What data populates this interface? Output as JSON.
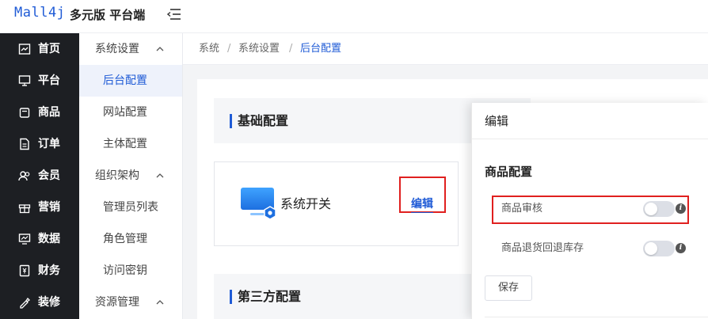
{
  "header": {
    "logo_text": "Mall4j",
    "brand_title": "多元版 平台端"
  },
  "main_nav": {
    "items": [
      {
        "label": "首页",
        "icon": "home-icon"
      },
      {
        "label": "平台",
        "icon": "monitor-icon"
      },
      {
        "label": "商品",
        "icon": "product-icon"
      },
      {
        "label": "订单",
        "icon": "order-icon"
      },
      {
        "label": "会员",
        "icon": "member-icon"
      },
      {
        "label": "营销",
        "icon": "gift-icon"
      },
      {
        "label": "数据",
        "icon": "chart-icon"
      },
      {
        "label": "财务",
        "icon": "finance-icon"
      },
      {
        "label": "装修",
        "icon": "decorate-icon"
      }
    ]
  },
  "sub_nav": {
    "items": [
      {
        "label": "系统设置",
        "type": "group",
        "expanded": true
      },
      {
        "label": "后台配置",
        "type": "child",
        "active": true
      },
      {
        "label": "网站配置",
        "type": "child"
      },
      {
        "label": "主体配置",
        "type": "child"
      },
      {
        "label": "组织架构",
        "type": "group",
        "expanded": true
      },
      {
        "label": "管理员列表",
        "type": "child"
      },
      {
        "label": "角色管理",
        "type": "child"
      },
      {
        "label": "访问密钥",
        "type": "child"
      },
      {
        "label": "资源管理",
        "type": "group",
        "expanded": true
      }
    ]
  },
  "breadcrumb": {
    "items": [
      "系统",
      "设置",
      "后台配置"
    ],
    "separator": "/",
    "level1": "系统",
    "level2": "系统设置",
    "current": "后台配置"
  },
  "sections": {
    "basic": "基础配置",
    "third_party": "第三方配置"
  },
  "card": {
    "title": "系统开关",
    "edit_label": "编辑"
  },
  "drawer": {
    "title": "编辑",
    "section_title": "商品配置",
    "rows": [
      {
        "label": "商品审核",
        "enabled": false
      },
      {
        "label": "商品退货回退库存",
        "enabled": false
      }
    ],
    "save_label": "保存"
  },
  "colors": {
    "accent": "#1f5bd6",
    "nav_bg": "#1d1f23",
    "highlight": "#e0201f"
  }
}
